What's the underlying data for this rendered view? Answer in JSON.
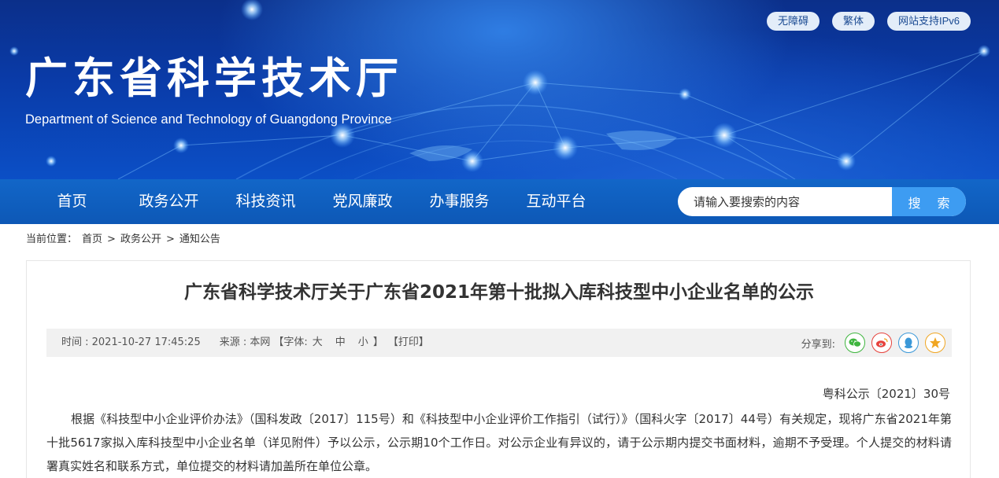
{
  "header": {
    "site_title": "广东省科学技术厅",
    "site_subtitle": "Department of Science and Technology of Guangdong Province",
    "top_links": [
      "无障碍",
      "繁体",
      "网站支持IPv6"
    ]
  },
  "nav": {
    "items": [
      "首页",
      "政务公开",
      "科技资讯",
      "党风廉政",
      "办事服务",
      "互动平台"
    ],
    "search_placeholder": "请输入要搜索的内容",
    "search_button": "搜 索"
  },
  "breadcrumb": {
    "prefix": "当前位置：",
    "items": [
      "首页",
      "政务公开",
      "通知公告"
    ],
    "separator": ">"
  },
  "article": {
    "title": "广东省科学技术厅关于广东省2021年第十批拟入库科技型中小企业名单的公示",
    "meta": {
      "time": "时间 : 2021-10-27 17:45:25",
      "source": "来源 : 本网",
      "font_label": "【字体:",
      "font_sizes": [
        "大",
        "中",
        "小"
      ],
      "font_close": "】",
      "print": "【打印】",
      "share_label": "分享到:"
    },
    "share_icons": [
      {
        "name": "wechat-icon",
        "color": "#3fb53f"
      },
      {
        "name": "weibo-icon",
        "color": "#e6423c"
      },
      {
        "name": "qq-icon",
        "color": "#3a98d8"
      },
      {
        "name": "qzone-icon",
        "color": "#f0a623"
      }
    ],
    "doc_number": "粤科公示〔2021〕30号",
    "body": "根据《科技型中小企业评价办法》（国科发政〔2017〕115号）和《科技型中小企业评价工作指引（试行）》（国科火字〔2017〕44号）有关规定，现将广东省2021年第十批5617家拟入库科技型中小企业名单（详见附件）予以公示，公示期10个工作日。对公示企业有异议的，请于公示期内提交书面材料，逾期不予受理。个人提交的材料请署真实姓名和联系方式，单位提交的材料请加盖所在单位公章。"
  }
}
